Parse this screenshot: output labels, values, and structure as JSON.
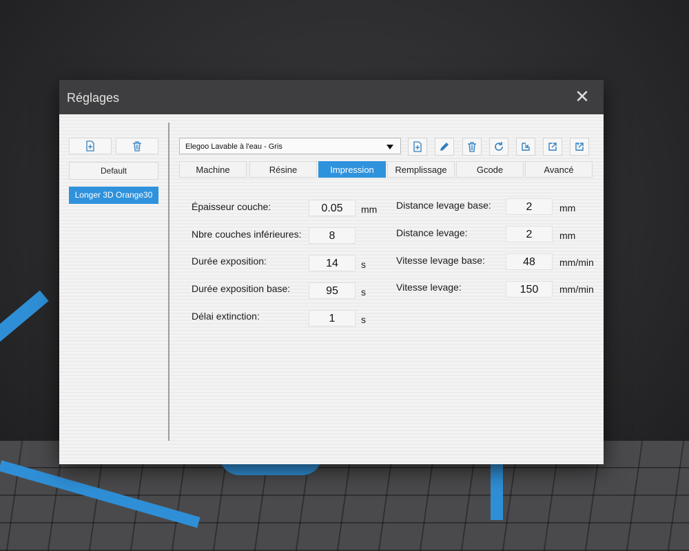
{
  "dialog": {
    "title": "Réglages",
    "close_glyph": "✕"
  },
  "left_panel": {
    "add_icon": "add-file-icon",
    "delete_icon": "trash-icon",
    "profiles": [
      {
        "label": "Default",
        "selected": false
      },
      {
        "label": "Longer 3D Orange30",
        "selected": true
      }
    ]
  },
  "right_panel": {
    "resin_profile": "Elegoo Lavable à l'eau - Gris",
    "toolbar_icons": [
      "add-file-icon",
      "pencil-icon",
      "trash-icon",
      "refresh-icon",
      "import-icon",
      "export-icon",
      "export-all-icon"
    ],
    "tabs": [
      {
        "label": "Machine",
        "active": false
      },
      {
        "label": "Résine",
        "active": false
      },
      {
        "label": "Impression",
        "active": true
      },
      {
        "label": "Remplissage",
        "active": false
      },
      {
        "label": "Gcode",
        "active": false
      },
      {
        "label": "Avancé",
        "active": false
      }
    ]
  },
  "settings_left": [
    {
      "label": "Épaisseur couche:",
      "value": "0.05",
      "unit": "mm"
    },
    {
      "label": "Nbre couches inférieures:",
      "value": "8",
      "unit": ""
    },
    {
      "label": "Durée exposition:",
      "value": "14",
      "unit": "s"
    },
    {
      "label": "Durée exposition base:",
      "value": "95",
      "unit": "s"
    },
    {
      "label": "Délai extinction:",
      "value": "1",
      "unit": "s"
    }
  ],
  "settings_right": [
    {
      "label": "Distance levage base:",
      "value": "2",
      "unit": "mm"
    },
    {
      "label": "Distance levage:",
      "value": "2",
      "unit": "mm"
    },
    {
      "label": "Vitesse levage base:",
      "value": "48",
      "unit": "mm/min"
    },
    {
      "label": "Vitesse levage:",
      "value": "150",
      "unit": "mm/min"
    }
  ],
  "colors": {
    "accent": "#2f92dc",
    "titlebar": "#3e3e40",
    "icon_blue": "#2f7fc0"
  }
}
